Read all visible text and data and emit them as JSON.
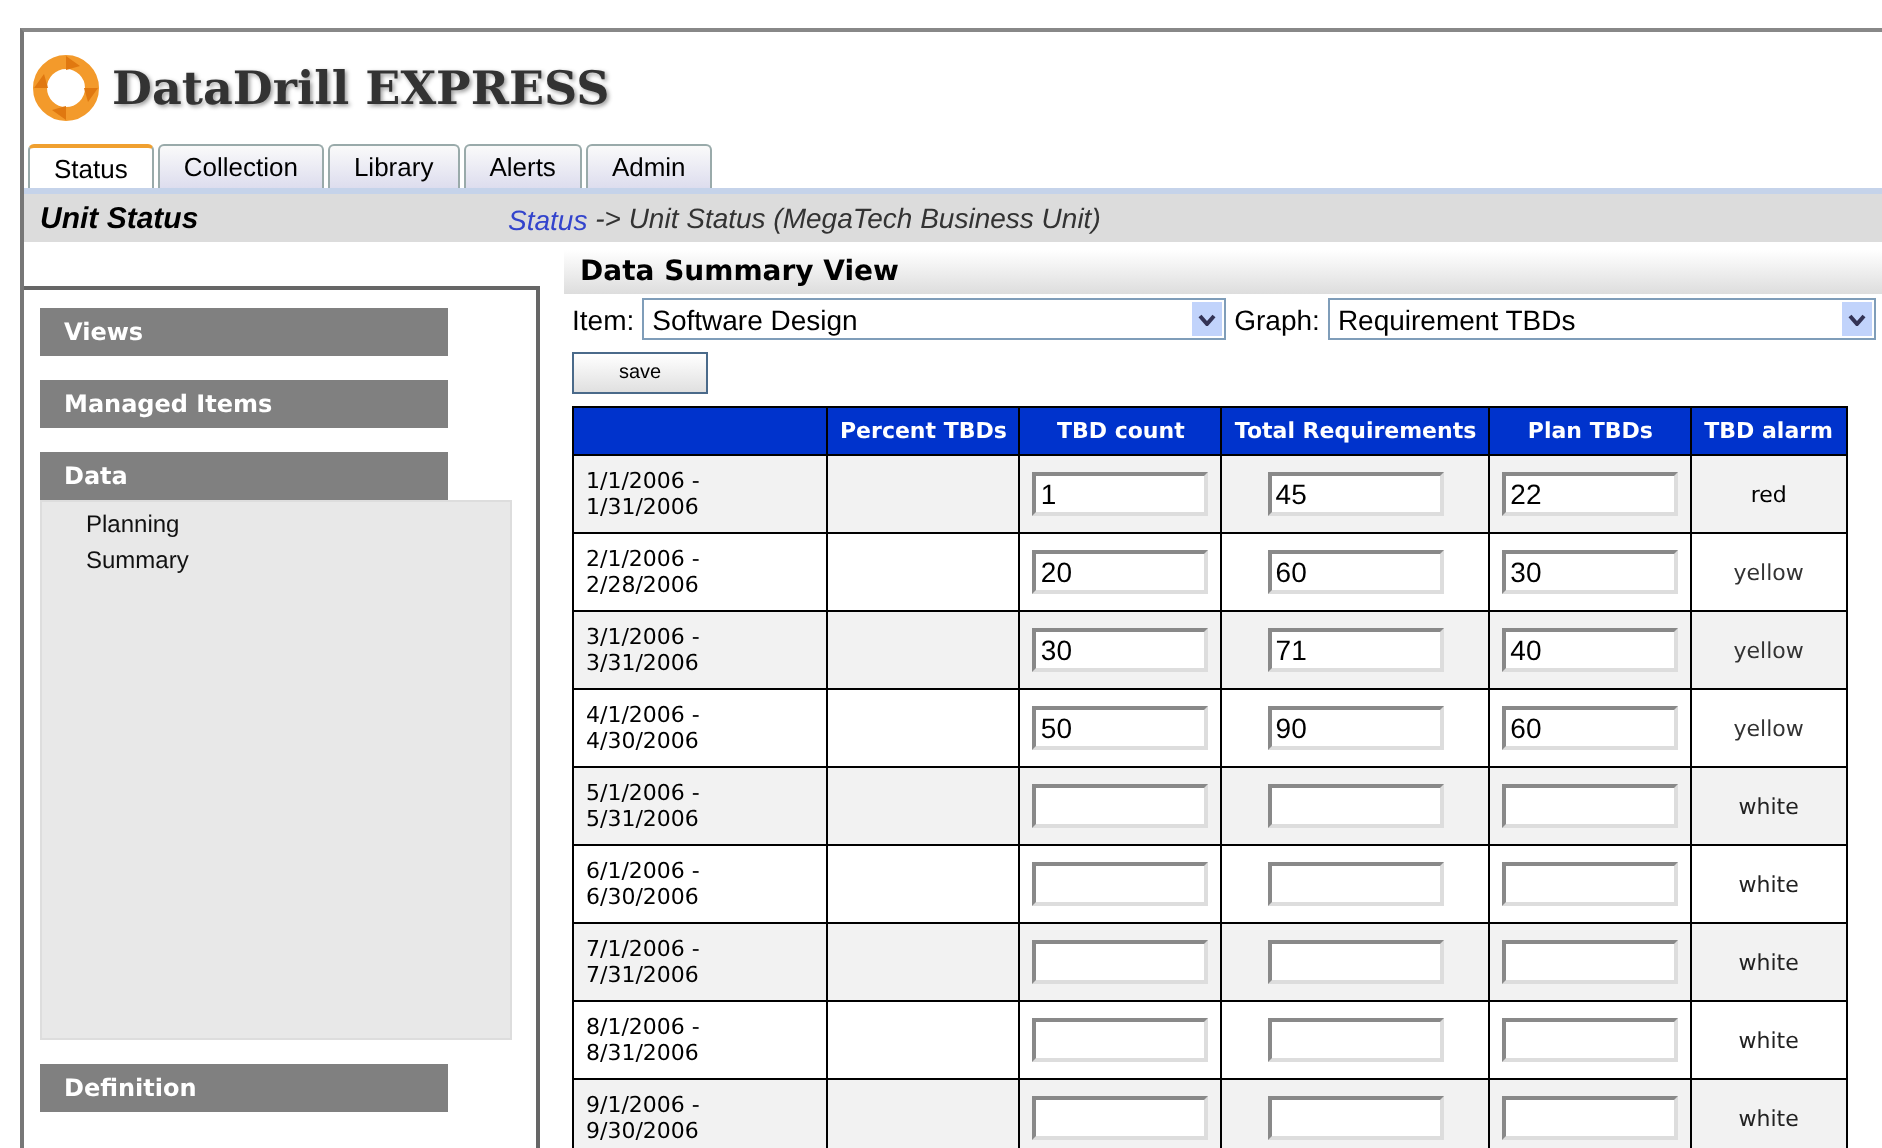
{
  "app": {
    "title": "DataDrill EXPRESS"
  },
  "tabs": [
    {
      "label": "Status",
      "selected": true
    },
    {
      "label": "Collection",
      "selected": false
    },
    {
      "label": "Library",
      "selected": false
    },
    {
      "label": "Alerts",
      "selected": false
    },
    {
      "label": "Admin",
      "selected": false
    }
  ],
  "page_bar": {
    "title": "Unit Status",
    "breadcrumb_link": "Status",
    "breadcrumb_rest": "-> Unit Status (MegaTech Business Unit)"
  },
  "sidebar": {
    "sections": [
      {
        "label": "Views",
        "expanded": false
      },
      {
        "label": "Managed Items",
        "expanded": false
      },
      {
        "label": "Data",
        "expanded": true,
        "items": [
          "Planning",
          "Summary"
        ]
      },
      {
        "label": "Definition",
        "expanded": false
      }
    ]
  },
  "view": {
    "title": "Data Summary View",
    "item_label": "Item:",
    "item_value": "Software Design",
    "graph_label": "Graph:",
    "graph_value": "Requirement TBDs",
    "save_button": "save"
  },
  "table": {
    "columns": [
      "Percent TBDs",
      "TBD count",
      "Total Requirements",
      "Plan TBDs",
      "TBD alarm"
    ],
    "rows": [
      {
        "period": "1/1/2006 - 1/31/2006",
        "tbd_count": "1",
        "total_requirements": "45",
        "plan_tbds": "22",
        "tbd_alarm": "red"
      },
      {
        "period": "2/1/2006 - 2/28/2006",
        "tbd_count": "20",
        "total_requirements": "60",
        "plan_tbds": "30",
        "tbd_alarm": "yellow"
      },
      {
        "period": "3/1/2006 - 3/31/2006",
        "tbd_count": "30",
        "total_requirements": "71",
        "plan_tbds": "40",
        "tbd_alarm": "yellow"
      },
      {
        "period": "4/1/2006 - 4/30/2006",
        "tbd_count": "50",
        "total_requirements": "90",
        "plan_tbds": "60",
        "tbd_alarm": "yellow"
      },
      {
        "period": "5/1/2006 - 5/31/2006",
        "tbd_alarm": "white"
      },
      {
        "period": "6/1/2006 - 6/30/2006",
        "tbd_alarm": "white"
      },
      {
        "period": "7/1/2006 - 7/31/2006",
        "tbd_alarm": "white"
      },
      {
        "period": "8/1/2006 - 8/31/2006",
        "tbd_alarm": "white"
      },
      {
        "period": "9/1/2006 - 9/30/2006",
        "tbd_alarm": "white"
      }
    ]
  }
}
